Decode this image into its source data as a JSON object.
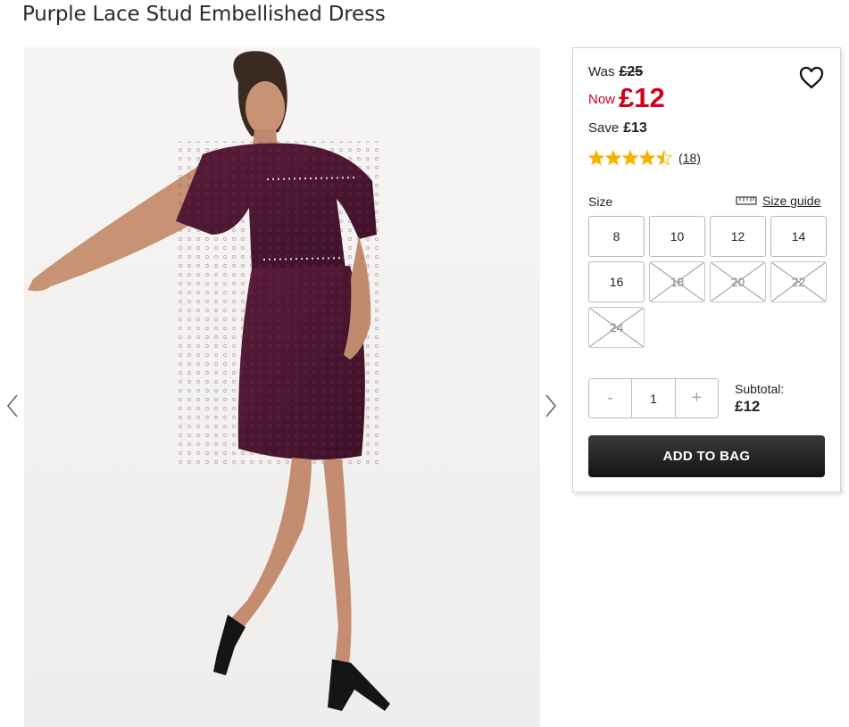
{
  "product": {
    "title": "Purple Lace Stud Embellished Dress",
    "image_alt": "Model wearing purple lace stud embellished dress"
  },
  "pricing": {
    "was_label": "Was",
    "was_value": "£25",
    "now_label": "Now",
    "now_value": "£12",
    "save_label": "Save",
    "save_value": "£13"
  },
  "rating": {
    "stars": 4.5,
    "max": 5,
    "review_count": "(18)"
  },
  "sizes": {
    "label": "Size",
    "guide_label": "Size guide",
    "options": [
      {
        "label": "8",
        "available": true
      },
      {
        "label": "10",
        "available": true
      },
      {
        "label": "12",
        "available": true
      },
      {
        "label": "14",
        "available": true
      },
      {
        "label": "16",
        "available": true
      },
      {
        "label": "18",
        "available": false
      },
      {
        "label": "20",
        "available": false
      },
      {
        "label": "22",
        "available": false
      },
      {
        "label": "24",
        "available": false
      }
    ]
  },
  "quantity": {
    "minus": "-",
    "value": "1",
    "plus": "+"
  },
  "subtotal": {
    "label": "Subtotal:",
    "value": "£12"
  },
  "cta": {
    "add_to_bag": "ADD TO BAG"
  },
  "colors": {
    "sale_red": "#d0021b",
    "star_gold": "#f5b301",
    "dress_plum": "#4a1530",
    "button_dark": "#1e1e1e"
  },
  "icons": {
    "wishlist": "heart-outline-icon",
    "size_guide": "ruler-icon",
    "prev": "chevron-left-icon",
    "next": "chevron-right-icon",
    "star": "star-icon"
  }
}
